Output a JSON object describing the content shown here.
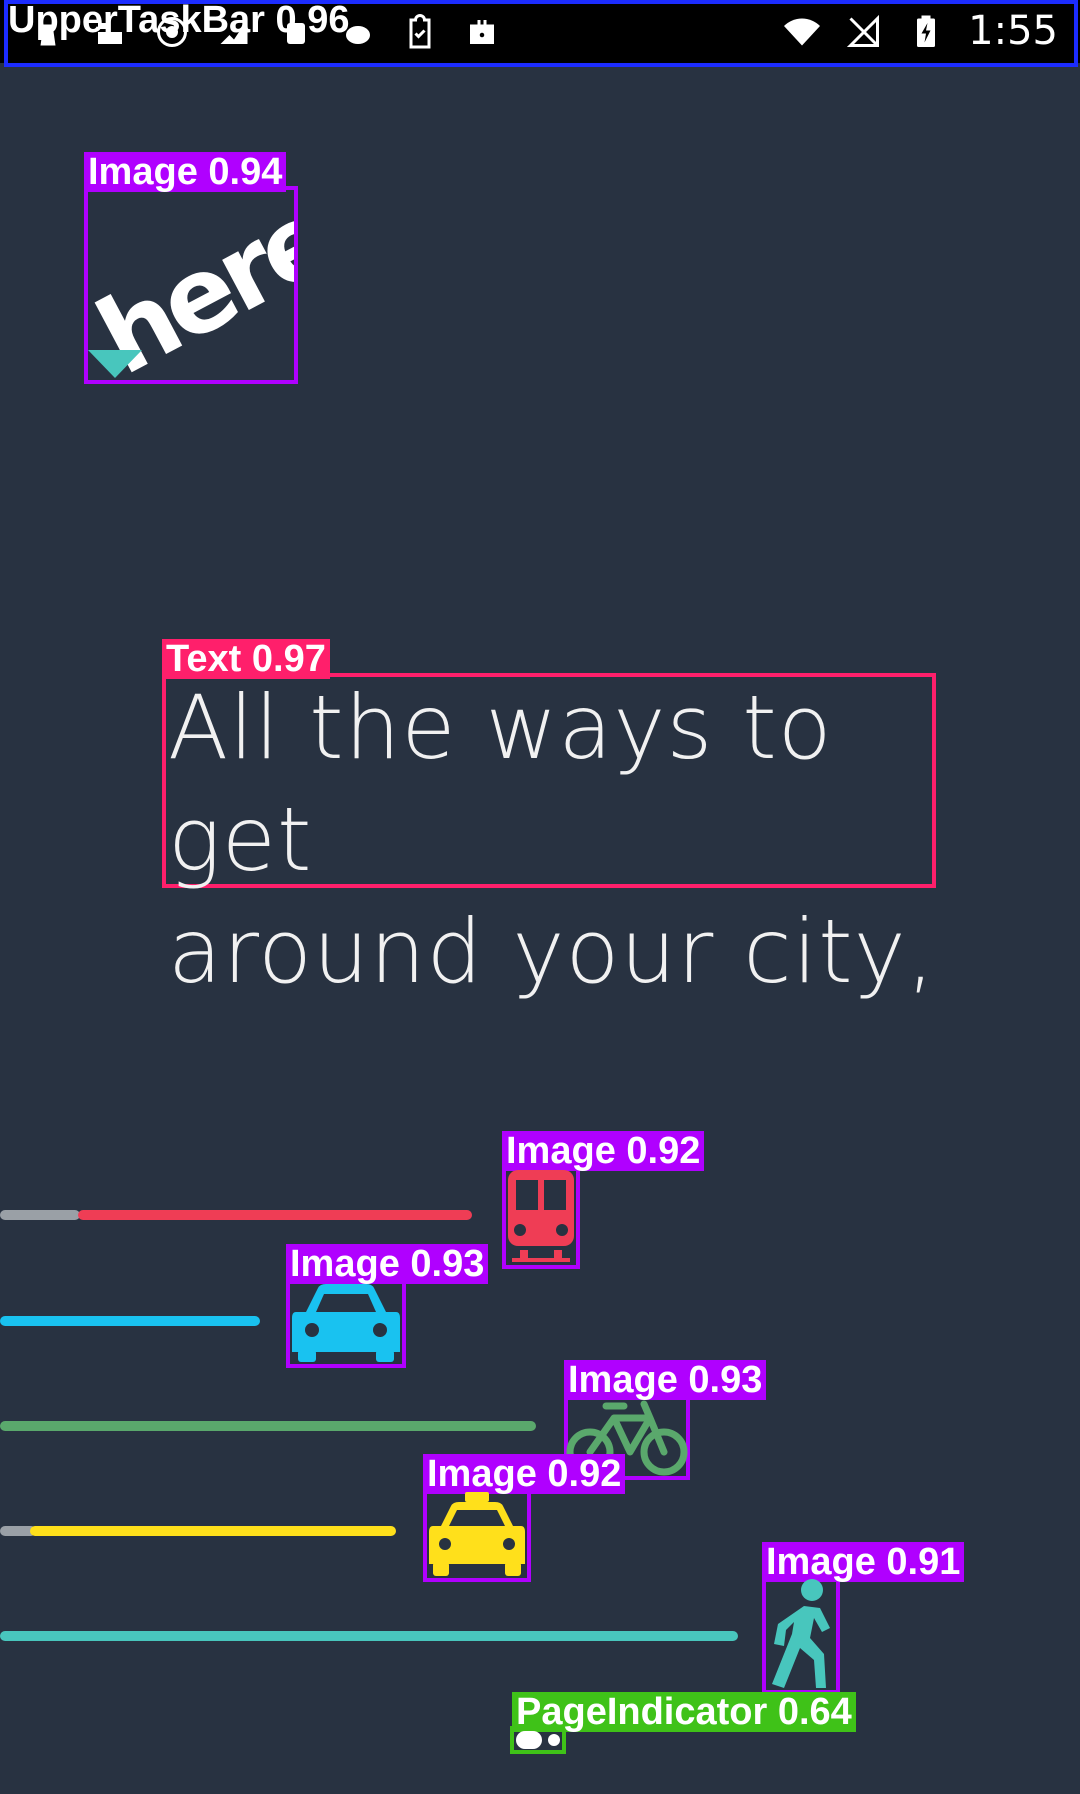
{
  "status_bar": {
    "time": "1:55",
    "left_icons": [
      "notification-icon",
      "notification-icon",
      "notification-icon",
      "notification-icon",
      "notification-icon",
      "notification-icon",
      "clipboard-check-icon",
      "briefcase-icon"
    ],
    "right_icons": [
      "wifi-icon",
      "no-sim-icon",
      "battery-charging-icon"
    ]
  },
  "detections": {
    "upper_task_bar": "UpperTaskBar 0.96",
    "logo_image": "Image 0.94",
    "headline_text": "Text 0.97",
    "bus_image": "Image 0.92",
    "car_image": "Image 0.93",
    "bike_image": "Image 0.93",
    "taxi_image": "Image 0.92",
    "walk_image": "Image 0.91",
    "page_indicator": "PageIndicator 0.64"
  },
  "logo": {
    "text": "here",
    "icon": "here-logo-icon"
  },
  "headline": {
    "line1": "All the ways to get",
    "line2": "around your city,"
  },
  "transport": {
    "bus_color": "#ef3d55",
    "car_color": "#19c2f0",
    "bike_color": "#5aa86c",
    "taxi_color": "#ffe01b",
    "walk_color": "#48c6bd",
    "track_gray": "#9aa0a6"
  },
  "page_indicator": {
    "count": 2,
    "active_index": 0
  },
  "colors": {
    "background": "#283241",
    "headline": "#f1f1f1"
  }
}
